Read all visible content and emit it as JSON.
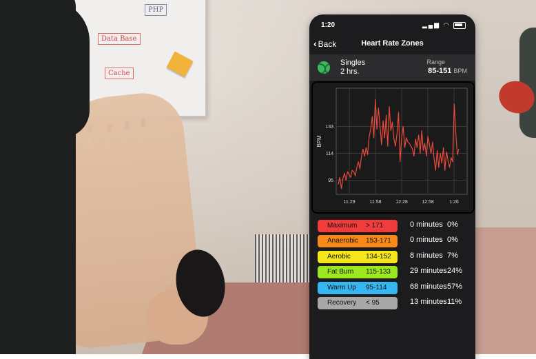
{
  "phone": {
    "status_time": "1:20",
    "nav": {
      "back_label": "Back",
      "title": "Heart Rate Zones"
    },
    "activity": {
      "name": "Singles",
      "duration": "2 hrs.",
      "range_label": "Range",
      "range_value": "85-151",
      "range_unit": "BPM"
    }
  },
  "chart_data": {
    "type": "line",
    "ylabel": "BPM",
    "xlabel": "",
    "x_ticks": [
      "11:29",
      "11:58",
      "12:28",
      "12:58",
      "1:26"
    ],
    "y_ticks": [
      95,
      114,
      133
    ],
    "ylim": [
      85,
      160
    ],
    "grid": true,
    "line_color": "#e84b3c",
    "series": [
      {
        "values": [
          92,
          97,
          89,
          96,
          100,
          95,
          101,
          99,
          97,
          102,
          101,
          98,
          104,
          108,
          103,
          112,
          117,
          112,
          118,
          113,
          126,
          131,
          140,
          125,
          152,
          131,
          146,
          133,
          120,
          137,
          125,
          141,
          119,
          147,
          130,
          136,
          124,
          119,
          128,
          143,
          108,
          125,
          133,
          118,
          125,
          122,
          121,
          119,
          117,
          112,
          124,
          118,
          127,
          114,
          130,
          116,
          121,
          112,
          126,
          120,
          114,
          122,
          110,
          102,
          116,
          104,
          114,
          107,
          118,
          102,
          115,
          109,
          104,
          111,
          108,
          149,
          129,
          113,
          117
        ]
      }
    ]
  },
  "zones": [
    {
      "name": "Maximum",
      "range": "> 171",
      "minutes": "0 minutes",
      "pct": "0%",
      "color": "#f23c3c"
    },
    {
      "name": "Anaerobic",
      "range": "153-171",
      "minutes": "0 minutes",
      "pct": "0%",
      "color": "#f98a1a"
    },
    {
      "name": "Aerobic",
      "range": "134-152",
      "minutes": "8 minutes",
      "pct": "7%",
      "color": "#f6e61c"
    },
    {
      "name": "Fat Burn",
      "range": "115-133",
      "minutes": "29 minutes",
      "pct": "24%",
      "color": "#9be81f"
    },
    {
      "name": "Warm Up",
      "range": "95-114",
      "minutes": "68 minutes",
      "pct": "57%",
      "color": "#36b7f2"
    },
    {
      "name": "Recovery",
      "range": "< 95",
      "minutes": "13 minutes",
      "pct": "11%",
      "color": "#a8a8a8"
    }
  ],
  "background": {
    "whiteboard_texts": [
      "Data Base",
      "Cache",
      "PHP"
    ]
  }
}
